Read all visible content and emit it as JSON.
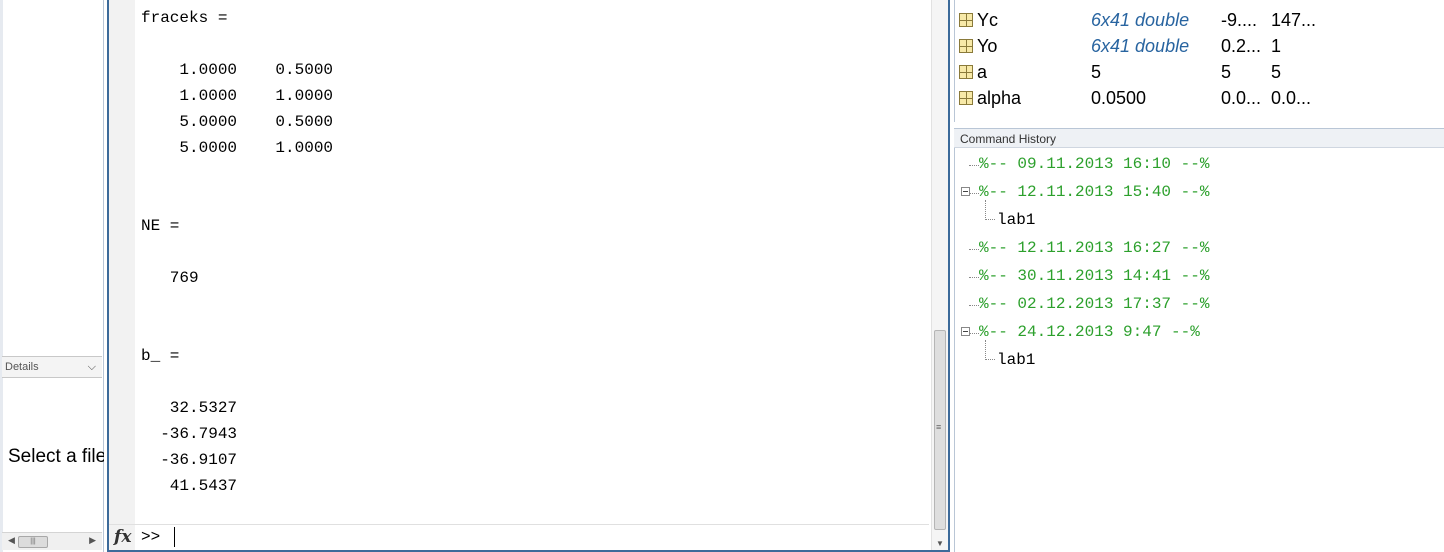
{
  "left_panel": {
    "details_label": "Details",
    "details_chevron": "chevron-down-icon",
    "select_file_text": "Select a file"
  },
  "command_window": {
    "output": {
      "fraceks_header": "fraceks =",
      "fraceks_rows": [
        "    1.0000    0.5000",
        "    1.0000    1.0000",
        "    5.0000    0.5000",
        "    5.0000    1.0000"
      ],
      "ne_header": "NE =",
      "ne_value": "   769",
      "b_header": "b_ =",
      "b_rows": [
        "   32.5327",
        "  -36.7943",
        "  -36.9107",
        "   41.5437"
      ]
    },
    "prompt": ">>",
    "fx_label": "fx"
  },
  "workspace": {
    "rows": [
      {
        "name": "Yc",
        "value": "6x41 double",
        "min": "-9....",
        "max": "147...",
        "link": true
      },
      {
        "name": "Yo",
        "value": "6x41 double",
        "min": "0.2...",
        "max": "1",
        "link": true
      },
      {
        "name": "a",
        "value": "5",
        "min": "5",
        "max": "5",
        "link": false
      },
      {
        "name": "alpha",
        "value": "0.0500",
        "min": "0.0...",
        "max": "0.0...",
        "link": false
      }
    ]
  },
  "command_history": {
    "title": "Command History",
    "entries": [
      {
        "text": "%-- 09.11.2013 16:10 --%",
        "kind": "session",
        "expanded": false
      },
      {
        "text": "%-- 12.11.2013 15:40 --%",
        "kind": "session",
        "expanded": true
      },
      {
        "text": "lab1",
        "kind": "command"
      },
      {
        "text": "%-- 12.11.2013 16:27 --%",
        "kind": "session",
        "expanded": false
      },
      {
        "text": "%-- 30.11.2013 14:41 --%",
        "kind": "session",
        "expanded": false
      },
      {
        "text": "%-- 02.12.2013 17:37 --%",
        "kind": "session",
        "expanded": false
      },
      {
        "text": "%-- 24.12.2013 9:47 --%",
        "kind": "session",
        "expanded": true
      },
      {
        "text": "lab1",
        "kind": "command"
      }
    ]
  },
  "colors": {
    "session_green": "#2ca02c",
    "link_blue": "#2864a0",
    "panel_border": "#3c6a9a"
  }
}
